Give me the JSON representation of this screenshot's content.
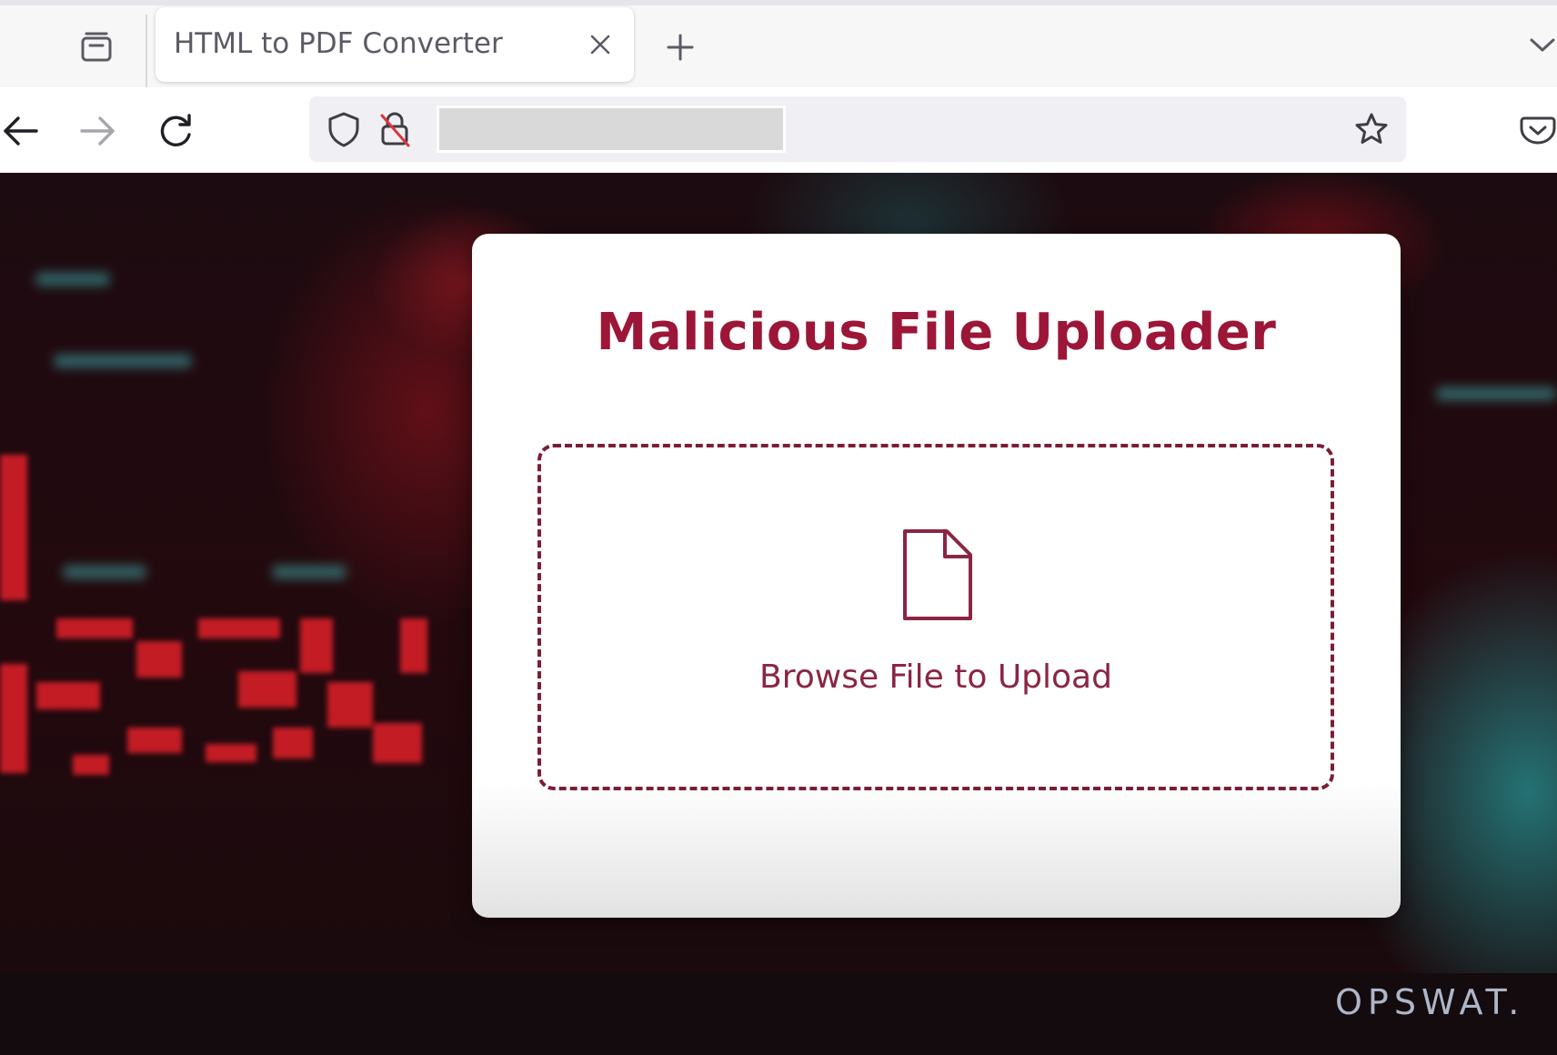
{
  "browser": {
    "tab": {
      "title": "HTML to PDF Converter"
    },
    "address_bar": {
      "url": ""
    }
  },
  "page": {
    "title": "Malicious File Uploader",
    "dropzone": {
      "label": "Browse File to Upload"
    }
  },
  "watermark": "OPSWAT.",
  "colors": {
    "accent": "#9c1638",
    "dropzone_border": "#7c1d36",
    "watermark": "#aeb6c8"
  },
  "icons": [
    "tab-overview-icon",
    "close-icon",
    "plus-icon",
    "chevron-down-icon",
    "back-arrow-icon",
    "forward-arrow-icon",
    "reload-icon",
    "shield-icon",
    "insecure-lock-icon",
    "star-icon",
    "pocket-icon",
    "file-icon"
  ]
}
